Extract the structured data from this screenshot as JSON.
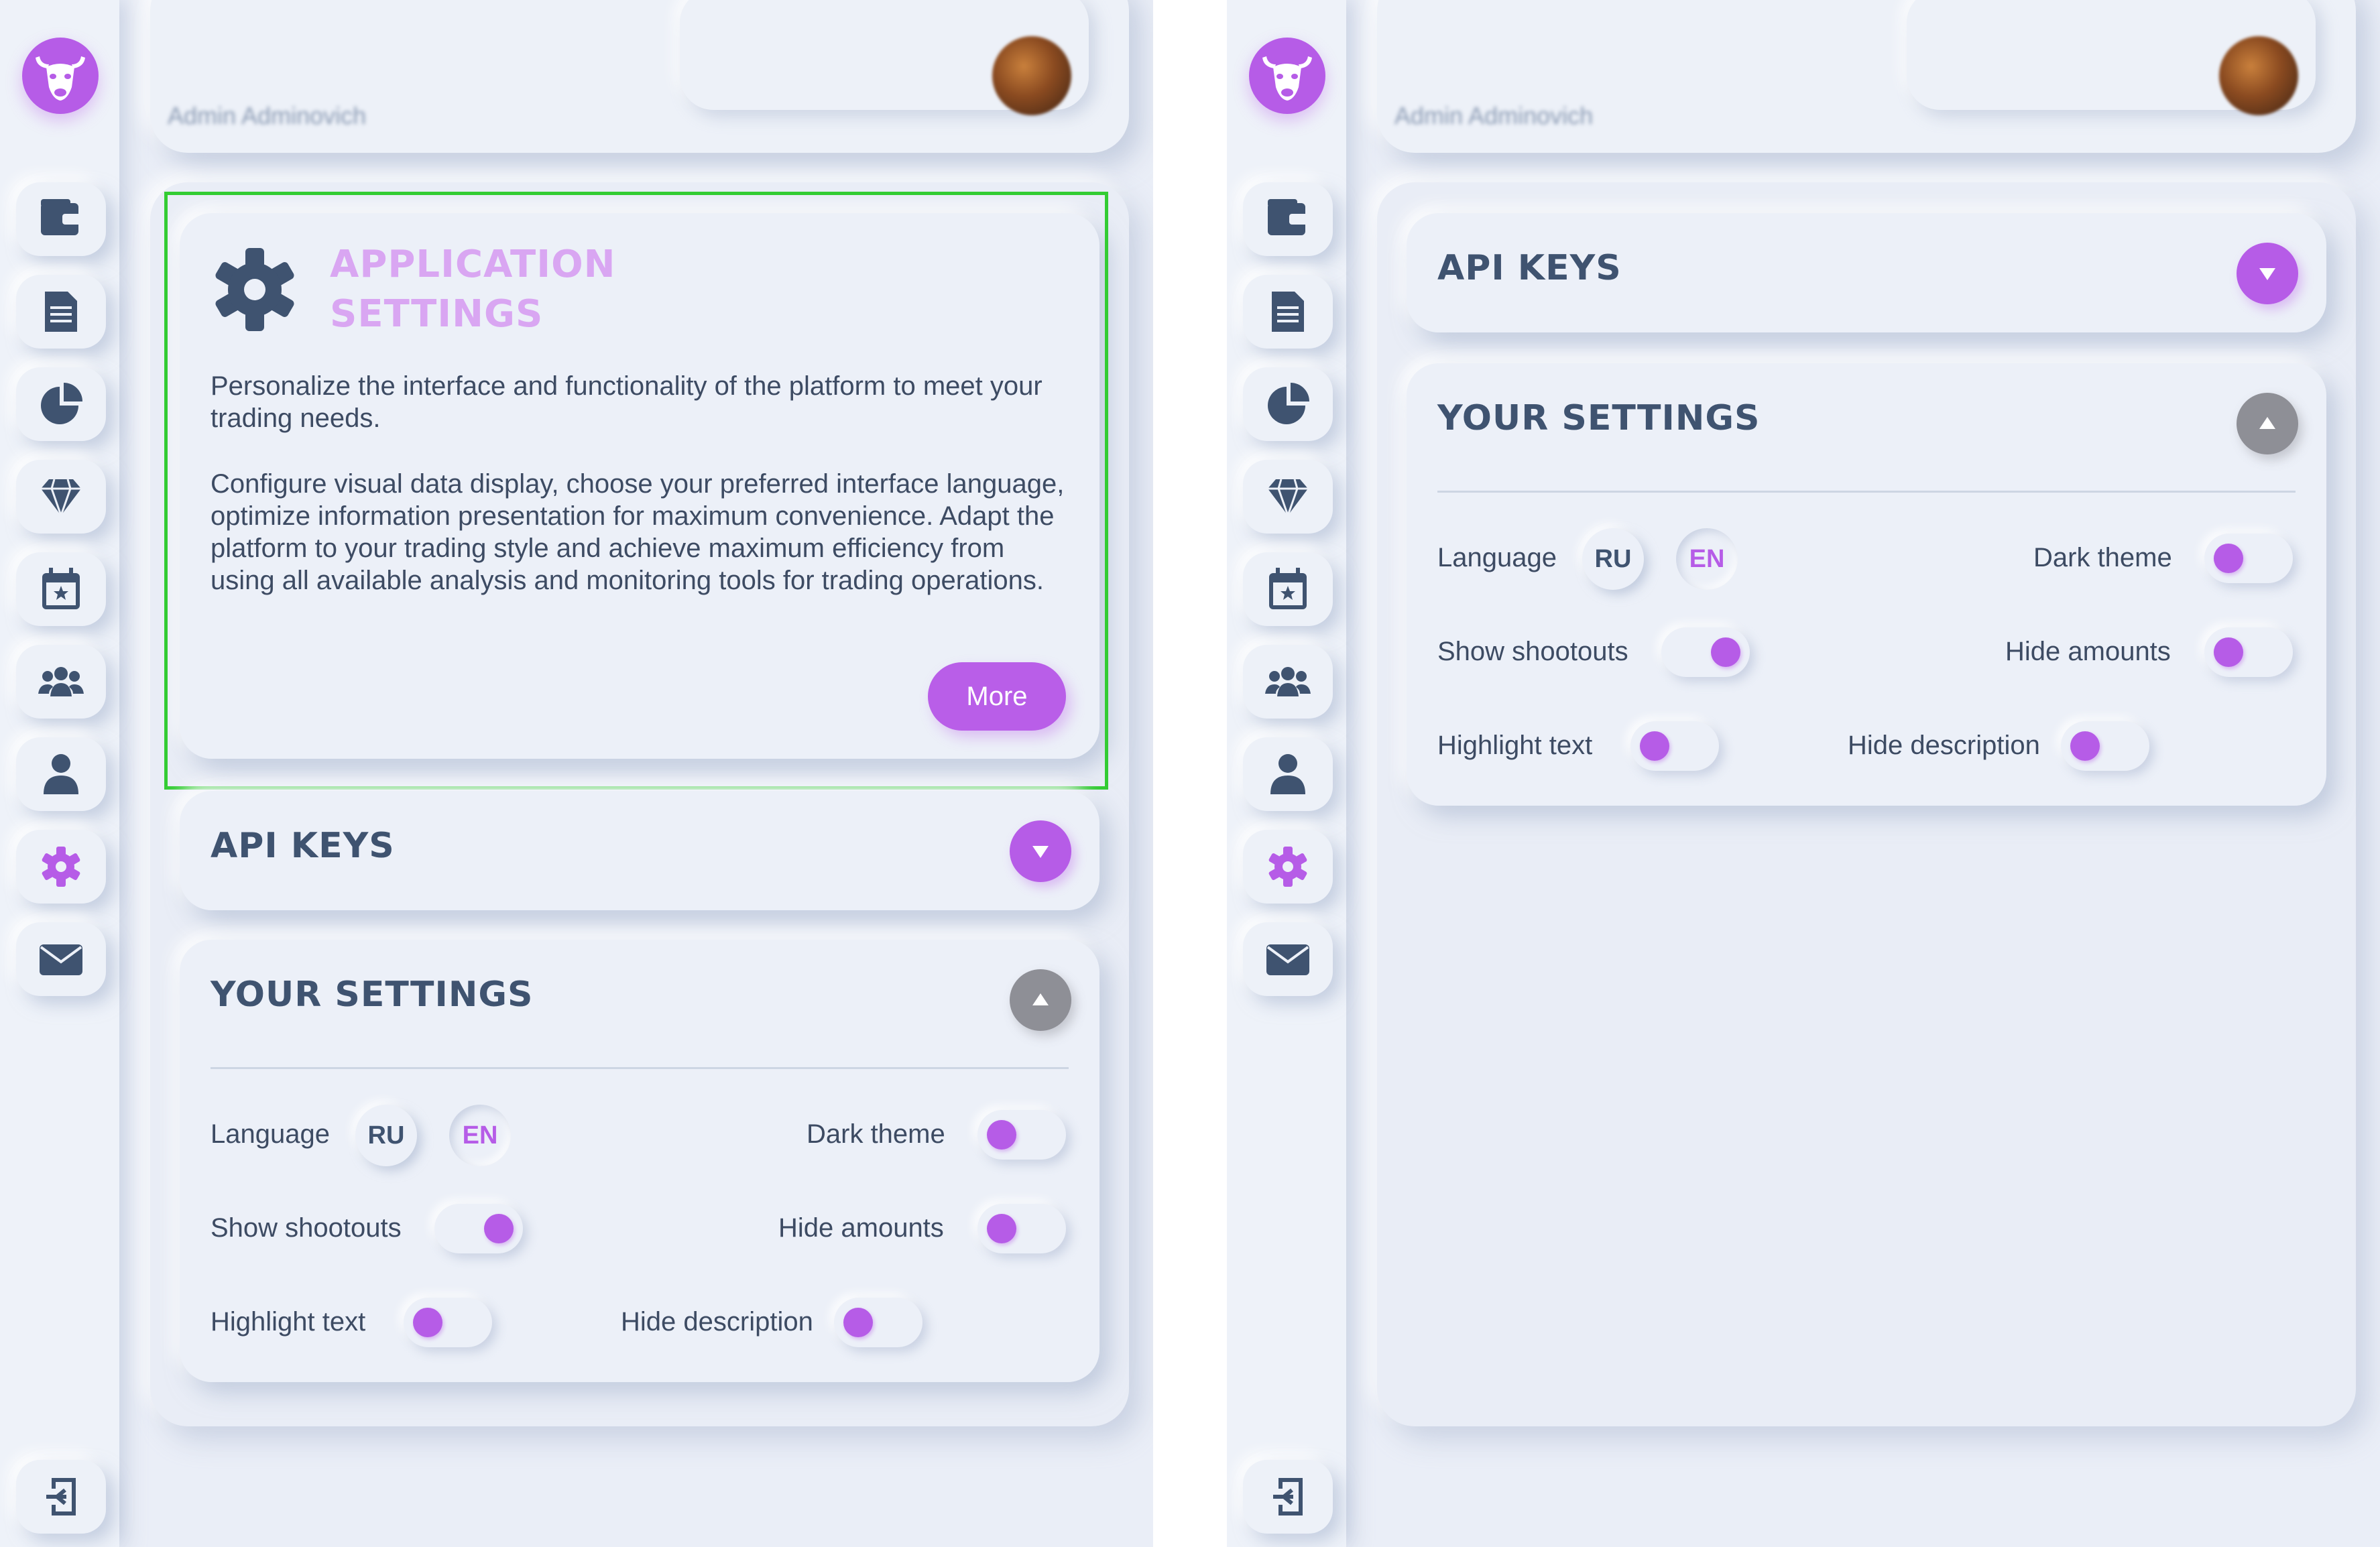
{
  "header": {
    "user_name": "Admin Adminovich"
  },
  "sidebar": {
    "logo": "bull-logo-icon",
    "items": [
      {
        "icon": "wallet-icon"
      },
      {
        "icon": "document-icon"
      },
      {
        "icon": "pie-chart-icon"
      },
      {
        "icon": "diamond-icon"
      },
      {
        "icon": "calendar-star-icon"
      },
      {
        "icon": "users-icon"
      },
      {
        "icon": "user-icon"
      },
      {
        "icon": "gear-icon",
        "active": true
      },
      {
        "icon": "envelope-icon"
      }
    ],
    "logout_icon": "logout-icon"
  },
  "app_settings": {
    "title_line1": "APPLICATION",
    "title_line2": "SETTINGS",
    "paragraph1": "Personalize the interface and functionality of the platform to meet your trading needs.",
    "paragraph2": "Configure visual data display, choose your preferred interface language, optimize information presentation for maximum convenience. Adapt the platform to your trading style and achieve maximum efficiency from using all available analysis and monitoring tools for trading operations.",
    "more_label": "More"
  },
  "api_keys": {
    "title": "API KEYS",
    "expanded": false
  },
  "your_settings": {
    "title": "YOUR SETTINGS",
    "expanded": true,
    "language_label": "Language",
    "lang_ru": "RU",
    "lang_en": "EN",
    "selected_language": "EN",
    "dark_theme_label": "Dark theme",
    "dark_theme": false,
    "show_shootouts_label": "Show shootouts",
    "show_shootouts": true,
    "hide_amounts_label": "Hide amounts",
    "hide_amounts": false,
    "highlight_text_label": "Highlight text",
    "highlight_text": false,
    "hide_description_label": "Hide description",
    "hide_description": false
  },
  "colors": {
    "accent": "#b65ce7",
    "title_dark": "#3f5370",
    "title_light": "#d9a6f2",
    "background": "#eaeef7",
    "collapse_button": "#8e8f96",
    "highlight_box": "#33cc33"
  }
}
